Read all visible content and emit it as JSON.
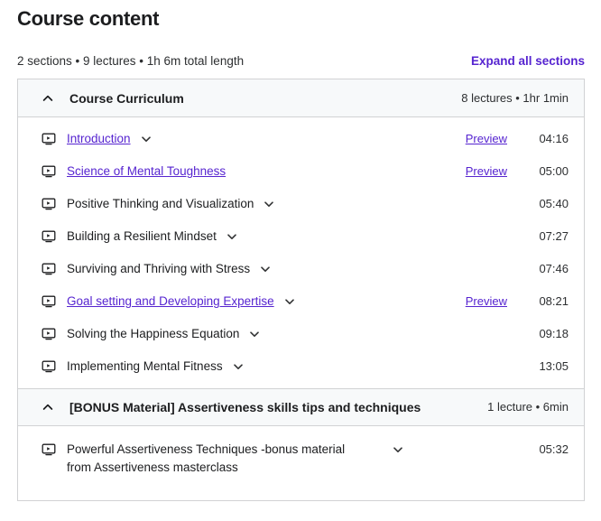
{
  "header": {
    "title": "Course content",
    "summary": "2 sections • 9 lectures • 1h 6m total length",
    "expand_all_label": "Expand all sections",
    "link_color": "#5624d0"
  },
  "sections": [
    {
      "title": "Course Curriculum",
      "meta": "8 lectures • 1hr 1min",
      "expanded": true,
      "toggle_icon": "chevron-up-icon",
      "lectures": [
        {
          "title": "Introduction",
          "is_link": true,
          "has_chevron": true,
          "preview": "Preview",
          "duration": "04:16",
          "icon": "play-video-icon"
        },
        {
          "title": "Science of Mental Toughness",
          "is_link": true,
          "has_chevron": false,
          "preview": "Preview",
          "duration": "05:00",
          "icon": "play-video-icon"
        },
        {
          "title": "Positive Thinking and Visualization",
          "is_link": false,
          "has_chevron": true,
          "preview": "",
          "duration": "05:40",
          "icon": "play-video-icon"
        },
        {
          "title": "Building a Resilient Mindset",
          "is_link": false,
          "has_chevron": true,
          "preview": "",
          "duration": "07:27",
          "icon": "play-video-icon"
        },
        {
          "title": "Surviving and Thriving with Stress",
          "is_link": false,
          "has_chevron": true,
          "preview": "",
          "duration": "07:46",
          "icon": "play-video-icon"
        },
        {
          "title": "Goal setting and Developing Expertise",
          "is_link": true,
          "has_chevron": true,
          "preview": "Preview",
          "duration": "08:21",
          "icon": "play-video-icon"
        },
        {
          "title": "Solving the Happiness Equation",
          "is_link": false,
          "has_chevron": true,
          "preview": "",
          "duration": "09:18",
          "icon": "play-video-icon"
        },
        {
          "title": "Implementing Mental Fitness",
          "is_link": false,
          "has_chevron": true,
          "preview": "",
          "duration": "13:05",
          "icon": "play-video-icon"
        }
      ]
    },
    {
      "title": "[BONUS Material] Assertiveness skills tips and techniques",
      "meta": "1 lecture • 6min",
      "expanded": true,
      "toggle_icon": "chevron-up-icon",
      "lectures": [
        {
          "title": "Powerful Assertiveness Techniques -bonus material from Assertiveness masterclass",
          "is_link": false,
          "has_chevron": true,
          "preview": "",
          "duration": "05:32",
          "icon": "play-video-icon"
        }
      ]
    }
  ]
}
